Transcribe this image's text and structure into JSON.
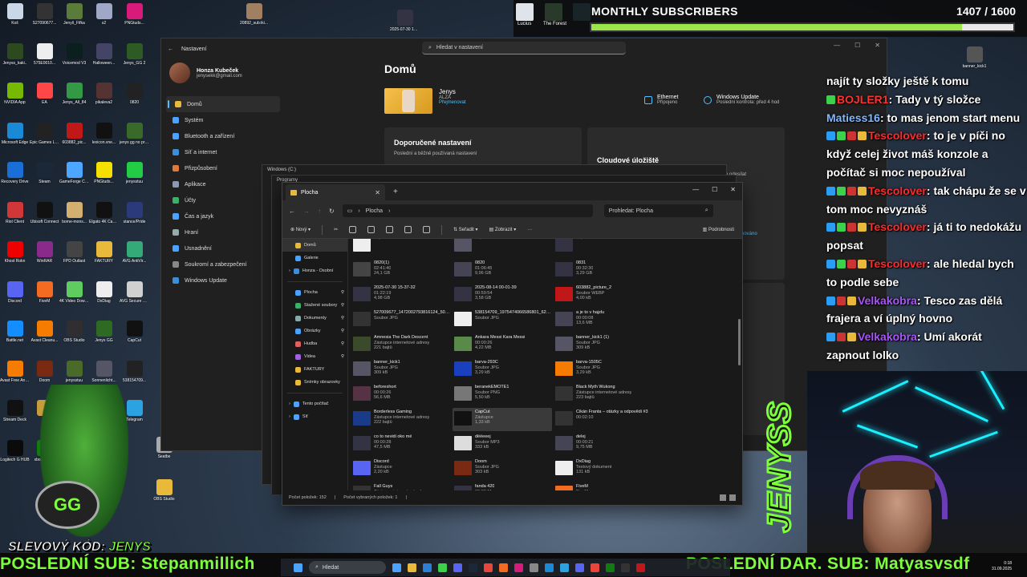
{
  "desktop": {
    "icons": [
      {
        "label": "Koš",
        "color": "#c9d7e6"
      },
      {
        "label": "S27090677...",
        "color": "#333"
      },
      {
        "label": "Jenyš_Fifka",
        "color": "#5a7b3a"
      },
      {
        "label": "s2",
        "color": "#a0a8c8"
      },
      {
        "label": "PNGtuds...",
        "color": "#d81b7a"
      },
      {
        "label": "Jenyss_kaki..",
        "color": "#2d4a1f"
      },
      {
        "label": "575E0010...",
        "color": "#eee"
      },
      {
        "label": "Voicemod V3",
        "color": "#0b1f1f"
      },
      {
        "label": "Halloween...",
        "color": "#446"
      },
      {
        "label": "Jenys_GG 2",
        "color": "#2e5a23"
      },
      {
        "label": "NVIDIA App",
        "color": "#76b900"
      },
      {
        "label": "EA",
        "color": "#ff4747"
      },
      {
        "label": "Jenys_All_84",
        "color": "#394"
      },
      {
        "label": "pikaleva2",
        "color": "#533"
      },
      {
        "label": "0820",
        "color": "#222"
      },
      {
        "label": "Microsoft Edge",
        "color": "#1b8ad6"
      },
      {
        "label": "Epic Games Launcher",
        "color": "#222"
      },
      {
        "label": "603882_pic...",
        "color": "#c01818"
      },
      {
        "label": "lexicon.vne...",
        "color": "#111"
      },
      {
        "label": "jenys gg no promo",
        "color": "#3a6a2a"
      },
      {
        "label": "Recovery Drive",
        "color": "#1a6ed8"
      },
      {
        "label": "Steam",
        "color": "#1b2838"
      },
      {
        "label": "GameForge Client",
        "color": "#4da6ff"
      },
      {
        "label": "PNGtuds...",
        "color": "#f5e000"
      },
      {
        "label": "jenysstuu",
        "color": "#2c4"
      },
      {
        "label": "Riot Client",
        "color": "#d13639"
      },
      {
        "label": "Ubisoft Connect",
        "color": "#111"
      },
      {
        "label": "borne-mons...",
        "color": "#d4b070"
      },
      {
        "label": "Elgato 4K Capture...",
        "color": "#111"
      },
      {
        "label": "stance/Pride",
        "color": "#2a3a7a"
      },
      {
        "label": "Khost Rokn",
        "color": "#e00"
      },
      {
        "label": "WinRAR",
        "color": "#8a2a8a"
      },
      {
        "label": "FPD Outlast",
        "color": "#444"
      },
      {
        "label": "FAKTURY",
        "color": "#e8b93b"
      },
      {
        "label": "AVG AntiVir...",
        "color": "#3a7"
      },
      {
        "label": "Discord",
        "color": "#5865f2"
      },
      {
        "label": "FiveM",
        "color": "#f26b21"
      },
      {
        "label": "4K Video Download...",
        "color": "#5fcc5f"
      },
      {
        "label": "DxDiag",
        "color": "#eee"
      },
      {
        "label": "AVG Secure Browser",
        "color": "#d0d0d0"
      },
      {
        "label": "Battle.net",
        "color": "#148eff"
      },
      {
        "label": "Avast Cleanu...",
        "color": "#f57c00"
      },
      {
        "label": "OBS Studio",
        "color": "#302e31"
      },
      {
        "label": "Jenys GG",
        "color": "#2e6a22"
      },
      {
        "label": "CapCut",
        "color": "#111"
      },
      {
        "label": "Avast Free Antivirus",
        "color": "#f57c00"
      },
      {
        "label": "Doom",
        "color": "#7a2a12"
      },
      {
        "label": "jenysstuu",
        "color": "#4a6a2a"
      },
      {
        "label": "Sonnenlicht...",
        "color": "#556"
      },
      {
        "label": "538154709...",
        "color": "#222"
      },
      {
        "label": "Stream Deck",
        "color": "#111"
      },
      {
        "label": "",
        "color": "#c79c3a"
      },
      {
        "label": "",
        "color": "#e0285a"
      },
      {
        "label": "",
        "color": "#2a2"
      },
      {
        "label": "Telegram",
        "color": "#2aa3e0"
      },
      {
        "label": "Logitech G HUB",
        "color": "#0b0b0b"
      },
      {
        "label": "xboxlogo-...",
        "color": "#107c10"
      },
      {
        "label": "Google Chrome",
        "color": "#e8453c"
      }
    ],
    "extra_icons": [
      {
        "label": "20892_sub:iki...",
        "color": "#a08060"
      },
      {
        "label": "2025-07-30 15-37-32",
        "color": "#334"
      },
      {
        "label": "banner_kick1",
        "color": "#555"
      },
      {
        "label": "OBS Studio",
        "color": "#e8b93b"
      },
      {
        "label": "Seatbe",
        "color": "#aaa"
      }
    ]
  },
  "sub_goal": {
    "title": "MONTHLY SUBSCRIBERS",
    "count": "1407 / 1600",
    "progress": 0.879,
    "thumbs": [
      {
        "label": "Lucius",
        "color": "#dfe4ea"
      },
      {
        "label": "The Forest",
        "color": "#2a3a2a"
      },
      {
        "label": "",
        "color": "#182428"
      }
    ]
  },
  "settings": {
    "window_title": "Nastavení",
    "search_placeholder": "Hledat v nastavení",
    "profile_name": "Honza Kubeček",
    "profile_email": "jenysekk@gmail.com",
    "nav": [
      {
        "label": "Domů",
        "color": "#e8b93b",
        "active": true
      },
      {
        "label": "Systém",
        "color": "#4aa3ff"
      },
      {
        "label": "Bluetooth a zařízení",
        "color": "#4aa3ff"
      },
      {
        "label": "Síť a internet",
        "color": "#3b8fd8"
      },
      {
        "label": "Přizpůsobení",
        "color": "#e07a3b"
      },
      {
        "label": "Aplikace",
        "color": "#8a9ab0"
      },
      {
        "label": "Účty",
        "color": "#3bb06a"
      },
      {
        "label": "Čas a jazyk",
        "color": "#4aa3ff"
      },
      {
        "label": "Hraní",
        "color": "#9aa"
      },
      {
        "label": "Usnadnění",
        "color": "#4aa3ff"
      },
      {
        "label": "Soukromí a zabezpečení",
        "color": "#888"
      },
      {
        "label": "Windows Update",
        "color": "#3b8fd8"
      }
    ],
    "heading": "Domů",
    "device_name": "Jenys",
    "device_sub": "ALZA",
    "device_rename": "Přejmenovat",
    "ethernet_title": "Ethernet",
    "ethernet_sub": "Připojeno",
    "update_title": "Windows Update",
    "update_sub": "Poslední kontrola: před 4 hod",
    "card1_title": "Doporučené nastavení",
    "card1_sub": "Poslední a běžně používaná nastavení",
    "card2_title": "Cloudové úložiště",
    "card2_extra": "o odesílat",
    "card2_extra2": "hováno"
  },
  "ghosts": [
    {
      "title": "Windows (C:)"
    },
    {
      "title": "Programy"
    }
  ],
  "explorer": {
    "tab_title": "Plocha",
    "address": "Plocha",
    "search_placeholder": "Prohledat: Plocha",
    "cmd": {
      "new": "Nový",
      "sort": "Seřadit",
      "view": "Zobrazit",
      "more": "···",
      "details": "Podrobnosti"
    },
    "sidebar": [
      {
        "label": "Domů",
        "color": "#e8b93b",
        "selected": true
      },
      {
        "label": "Galerie",
        "color": "#4aa3ff"
      },
      {
        "label": "Honza - Osobní",
        "color": "#3b8fd8"
      },
      {
        "label": "Plocha",
        "color": "#4aa3ff"
      },
      {
        "label": "Stažené soubory",
        "color": "#3bb06a"
      },
      {
        "label": "Dokumenty",
        "color": "#8aa"
      },
      {
        "label": "Obrázky",
        "color": "#4aa3ff"
      },
      {
        "label": "Hudba",
        "color": "#e06060"
      },
      {
        "label": "Videa",
        "color": "#a060e0"
      },
      {
        "label": "FAKTURY",
        "color": "#e8b93b"
      },
      {
        "label": "Snímky obrazovky",
        "color": "#e8b93b"
      },
      {
        "label": "Tento počítač",
        "color": "#4aa3ff"
      },
      {
        "label": "Síť",
        "color": "#4aa3ff"
      }
    ],
    "files": [
      {
        "name": "",
        "meta1": "33,9 kB",
        "meta2": "",
        "color": "#eee"
      },
      {
        "name": "",
        "meta1": "20,5 MB",
        "meta2": "",
        "color": "#556"
      },
      {
        "name": "",
        "meta1": "21,4 MB",
        "meta2": "",
        "color": "#334"
      },
      {
        "name": "0820(1)",
        "meta1": "02:41:40",
        "meta2": "24,1 GB",
        "color": "#444"
      },
      {
        "name": "0820",
        "meta1": "01:06:45",
        "meta2": "9,96 GB",
        "color": "#445"
      },
      {
        "name": "0831",
        "meta1": "00:32:30",
        "meta2": "3,29 GB",
        "color": "#334"
      },
      {
        "name": "2025-07-30 15-37-32",
        "meta1": "01:22:19",
        "meta2": "4,98 GB",
        "color": "#334"
      },
      {
        "name": "2025-08-14 00-01-39",
        "meta1": "00:59:54",
        "meta2": "3,58 GB",
        "color": "#334"
      },
      {
        "name": "603882_picture_2",
        "meta1": "Soubor WEBP",
        "meta2": "4,00 kB",
        "color": "#c01818"
      },
      {
        "name": "527009677_1472002793816124_5029351410753795634_n",
        "meta1": "Soubor JPG",
        "meta2": "",
        "color": "#333"
      },
      {
        "name": "538154709_1975474066586801_625863420113886796_n",
        "meta1": "Soubor JPG",
        "meta2": "",
        "color": "#eee"
      },
      {
        "name": "a je to v hajzlu",
        "meta1": "00:00:08",
        "meta2": "13,6 MB",
        "color": "#445"
      },
      {
        "name": "Amnesia The Dark Descent",
        "meta1": "Zástupce internetové adresy",
        "meta2": "221 bajtů",
        "color": "#3a4a2a"
      },
      {
        "name": "Ankara Messi Kara Messi",
        "meta1": "00:00:26",
        "meta2": "4,22 MB",
        "color": "#5a8a4a"
      },
      {
        "name": "banner_kick1 (1)",
        "meta1": "Soubor JPG",
        "meta2": "309 kB",
        "color": "#556"
      },
      {
        "name": "banner_kick1",
        "meta1": "Soubor JPG",
        "meta2": "309 kB",
        "color": "#556"
      },
      {
        "name": "barva-293C",
        "meta1": "Soubor JPG",
        "meta2": "3,29 kB",
        "color": "#1a3fbf"
      },
      {
        "name": "barva-1505C",
        "meta1": "Soubor JPG",
        "meta2": "3,29 kB",
        "color": "#f57c00"
      },
      {
        "name": "beforeshort",
        "meta1": "00:00:26",
        "meta2": "56,6 MB",
        "color": "#534"
      },
      {
        "name": "beranekEMOTE1",
        "meta1": "Soubor PNG",
        "meta2": "5,50 kB",
        "color": "#777"
      },
      {
        "name": "Black Myth Wukong",
        "meta1": "Zástupce internetové adresy",
        "meta2": "223 bajtů",
        "color": "#333"
      },
      {
        "name": "Borderless Gaming",
        "meta1": "Zástupce internetové adresy",
        "meta2": "222 bajtů",
        "color": "#1a3a8a"
      },
      {
        "name": "CapCut",
        "meta1": "Zástupce",
        "meta2": "1,33 kB",
        "color": "#111",
        "selected": true
      },
      {
        "name": "Cikán Franta – otázky a odpovědi #3",
        "meta1": "00:02:10",
        "meta2": "",
        "color": "#333"
      },
      {
        "name": "co to nevidi oko mé",
        "meta1": "00:00:28",
        "meta2": "47,5 MB",
        "color": "#334"
      },
      {
        "name": "dëëeeej",
        "meta1": "Soubor MP3",
        "meta2": "333 kB",
        "color": "#ddd"
      },
      {
        "name": "delej",
        "meta1": "00:00:21",
        "meta2": "9,75 MB",
        "color": "#445"
      },
      {
        "name": "Discord",
        "meta1": "Zástupce",
        "meta2": "2,20 kB",
        "color": "#5865f2"
      },
      {
        "name": "Doom",
        "meta1": "Soubor JPG",
        "meta2": "303 kB",
        "color": "#7a2a12"
      },
      {
        "name": "DxDiag",
        "meta1": "Textový dokument",
        "meta2": "131 kB",
        "color": "#eee"
      },
      {
        "name": "Fall Guys",
        "meta1": "Zástupce internetové adresy",
        "meta2": "",
        "color": "#333"
      },
      {
        "name": "fanda 420",
        "meta1": "00:00:11",
        "meta2": "3,15 MB",
        "color": "#334"
      },
      {
        "name": "FiveM",
        "meta1": "FiveM",
        "meta2": "Cfx.re",
        "color": "#f26b21"
      }
    ],
    "status_count": "Počet položek: 152",
    "status_selected": "Počet vybraných položek: 1"
  },
  "chat": [
    {
      "user": "",
      "text": "najít ty složky ještě k tomu",
      "color": "#fff",
      "badges": []
    },
    {
      "user": "BOJLER1",
      "text": ": Tady v tý složce",
      "color": "#ff3030",
      "badges": [
        "#3bd14a"
      ]
    },
    {
      "user": "Matiess16",
      "text": ": to mas jenom start menu",
      "color": "#7fb8ff",
      "badges": []
    },
    {
      "user": "Tescolover",
      "text": ": to je v píči no když celej život máš konzole a počítač si moc nepoužíval",
      "color": "#ff2a2a",
      "badges": [
        "#2a9df4",
        "#3bd14a",
        "#c33",
        "#e8b93b"
      ]
    },
    {
      "user": "Tescolover",
      "text": ": tak chápu že se v tom moc nevyznáš",
      "color": "#ff2a2a",
      "badges": [
        "#2a9df4",
        "#3bd14a",
        "#c33",
        "#e8b93b"
      ]
    },
    {
      "user": "Tescolover",
      "text": ": já ti to nedokážu popsat",
      "color": "#ff2a2a",
      "badges": [
        "#2a9df4",
        "#3bd14a",
        "#c33",
        "#e8b93b"
      ]
    },
    {
      "user": "Tescolover",
      "text": ": ale hledal bych to podle sebe",
      "color": "#ff2a2a",
      "badges": [
        "#2a9df4",
        "#3bd14a",
        "#c33",
        "#e8b93b"
      ]
    },
    {
      "user": "Velkakobra",
      "text": ": Tesco zas dělá frajera a ví úplný hovno",
      "color": "#a855f7",
      "badges": [
        "#2a9df4",
        "#c33",
        "#e8b93b"
      ]
    },
    {
      "user": "Velkakobra",
      "text": ": Umí akorát zapnout lolko",
      "color": "#a855f7",
      "badges": [
        "#2a9df4",
        "#c33",
        "#e8b93b"
      ]
    }
  ],
  "logo_text": "JENYSS",
  "mascot_text": "GG",
  "promo": {
    "label": "SLEVOVÝ KÓD:",
    "code": "JENYS"
  },
  "ticker": {
    "left": "POSLEDNÍ SUB: Stepanmillich",
    "right": "POSLEDNÍ DAR. SUB: Matyasvsdf"
  },
  "taskbar": {
    "search": "Hledat",
    "icons": [
      "#4aa3ff",
      "#e8b93b",
      "#2a7fd8",
      "#3bd14a",
      "#5865f2",
      "#1b2838",
      "#e8453c",
      "#f26b21",
      "#d81b7a",
      "#888",
      "#1b8ad6",
      "#2aa3e0",
      "#5865f2",
      "#e8453c",
      "#107c10",
      "#333",
      "#c01818"
    ],
    "time": "0:18",
    "date": "31.09.2025"
  }
}
